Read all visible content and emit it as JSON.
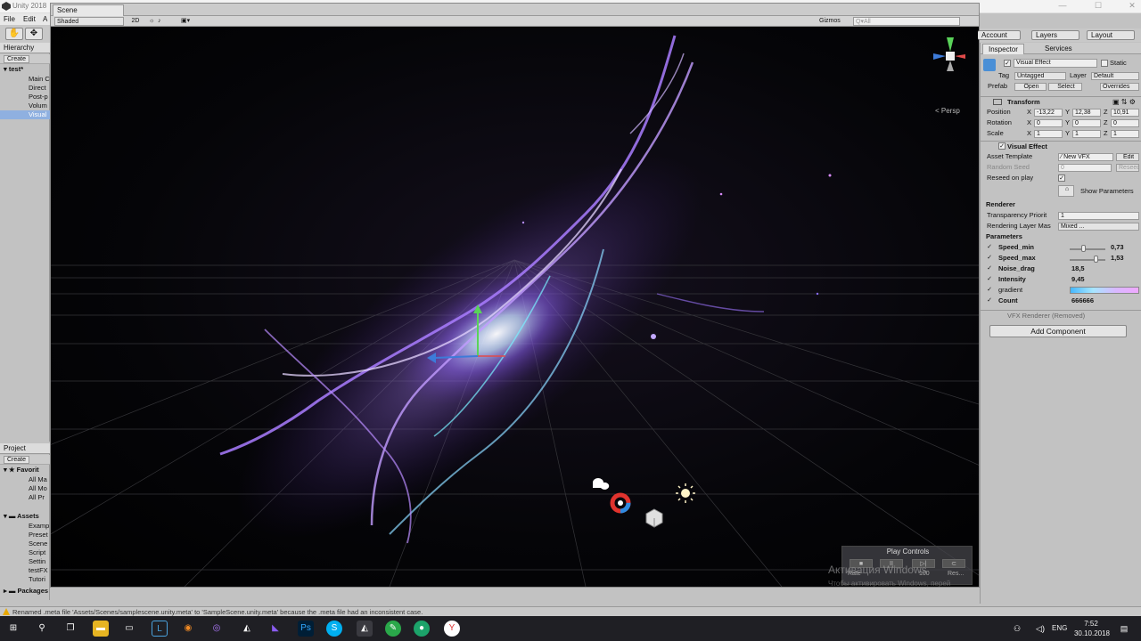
{
  "window": {
    "title": "Unity 2018",
    "min": "—",
    "max": "☐",
    "close": "✕"
  },
  "menu": [
    "File",
    "Edit",
    "A"
  ],
  "hierarchy": {
    "tab": "Hierarchy",
    "create": "Create",
    "root": "test*",
    "items": [
      "Main C",
      "Direct",
      "Post-p",
      "Volum",
      "Visual"
    ]
  },
  "project": {
    "tab": "Project",
    "create": "Create",
    "favorites": "Favorit",
    "fav_items": [
      "All Ma",
      "All Mo",
      "All Pr"
    ],
    "assets": "Assets",
    "asset_items": [
      "Examp",
      "Preset",
      "Scene",
      "Script",
      "Settin",
      "testFX",
      "Tutori"
    ],
    "packages": "Packages"
  },
  "scene": {
    "tab": "Scene",
    "shading": "Shaded",
    "mode2d": "2D",
    "gizmos": "Gizmos",
    "search_placeholder": "Q▾All",
    "persp": "< Persp"
  },
  "play_controls": {
    "title": "Play Controls",
    "buttons": [
      "■",
      "II",
      "▷|",
      "⊂"
    ],
    "rate": "Rate",
    "rate_val": "100",
    "reset": "Res..."
  },
  "activation": {
    "line1": "Активация Windows",
    "line2": "Чтобы активировать Windows, перей"
  },
  "top_right": {
    "account": "Account",
    "layers": "Layers",
    "layout": "Layout"
  },
  "inspector": {
    "tabs": [
      "Inspector",
      "Services"
    ],
    "object_name": "Visual Effect",
    "static": "Static",
    "tag_label": "Tag",
    "tag_value": "Untagged",
    "layer_label": "Layer",
    "layer_value": "Default",
    "prefab_label": "Prefab",
    "prefab_open": "Open",
    "prefab_select": "Select",
    "prefab_overrides": "Overrides",
    "transform": {
      "title": "Transform",
      "rows": [
        {
          "label": "Position",
          "x": "-13,22",
          "y": "12,38",
          "z": "10,91"
        },
        {
          "label": "Rotation",
          "x": "0",
          "y": "0",
          "z": "0"
        },
        {
          "label": "Scale",
          "x": "1",
          "y": "1",
          "z": "1"
        }
      ]
    },
    "vfx": {
      "title": "Visual Effect",
      "asset_template_label": "Asset Template",
      "asset_template_value": "New VFX",
      "edit": "Edit",
      "random_seed_label": "Random Seed",
      "random_seed_value": "0",
      "reseed_btn": "Reseed",
      "reseed_on_play": "Reseed on play",
      "show_params": "Show Parameters",
      "renderer_header": "Renderer",
      "transparency_label": "Transparency Priorit",
      "transparency_value": "1",
      "rendering_layer_label": "Rendering Layer Mas",
      "rendering_layer_value": "Mixed ...",
      "parameters_header": "Parameters",
      "params": [
        {
          "name": "Speed_min",
          "value": "0,73",
          "slider": 0.35
        },
        {
          "name": "Speed_max",
          "value": "1,53",
          "slider": 0.75
        },
        {
          "name": "Noise_drag",
          "value": "18,5"
        },
        {
          "name": "Intensity",
          "value": "9,45"
        },
        {
          "name": "gradient",
          "value": ""
        },
        {
          "name": "Count",
          "value": "666666"
        }
      ],
      "removed": "VFX Renderer (Removed)"
    },
    "add_component": "Add Component"
  },
  "status": {
    "message": "Renamed .meta file 'Assets/Scenes/samplescene.unity.meta' to 'SampleScene.unity.meta' because the .meta file had an inconsistent case."
  },
  "taskbar": {
    "lang": "ENG",
    "time": "7:52",
    "date": "30.10.2018"
  },
  "colors": {
    "accent": "#3d7bd9",
    "vfx_purple": "#9b6dff",
    "vfx_cyan": "#7fe8ff"
  }
}
